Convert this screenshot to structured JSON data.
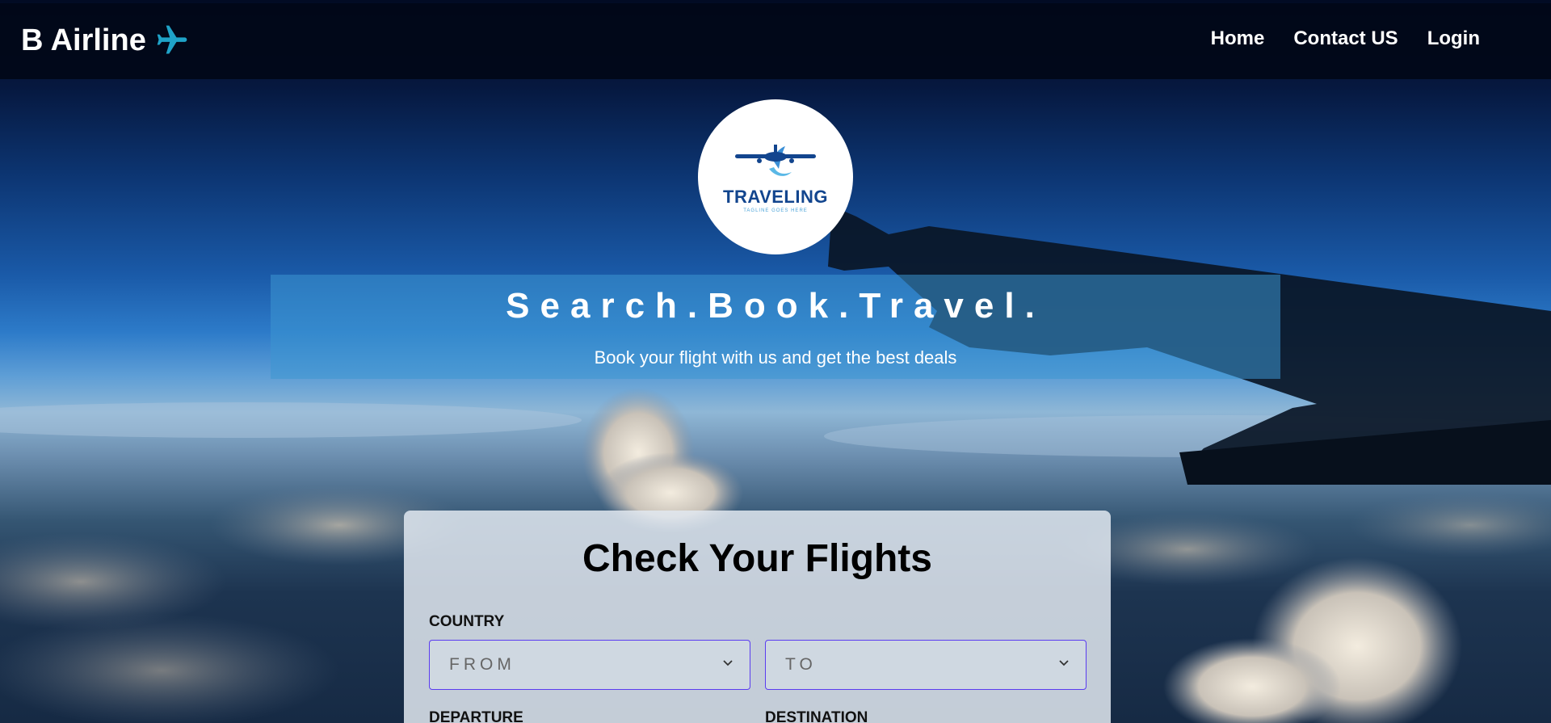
{
  "brand": {
    "name": "B Airline",
    "icon": "airplane-icon",
    "icon_color": "#1fa3c8"
  },
  "nav": {
    "items": [
      {
        "label": "Home"
      },
      {
        "label": "Contact US"
      },
      {
        "label": "Login"
      }
    ]
  },
  "logo": {
    "text": "TRAVELING",
    "tagline": "TAGLINE GOES HERE",
    "color": "#12458e"
  },
  "hero": {
    "title": "Search.Book.Travel.",
    "subtitle": "Book your flight with us and get the best deals"
  },
  "search": {
    "title": "Check Your Flights",
    "country_label": "COUNTRY",
    "from": {
      "value": "FROM"
    },
    "to": {
      "value": "TO"
    },
    "departure_label": "DEPARTURE",
    "destination_label": "DESTINATION",
    "accent_color": "#5a3cf0"
  }
}
